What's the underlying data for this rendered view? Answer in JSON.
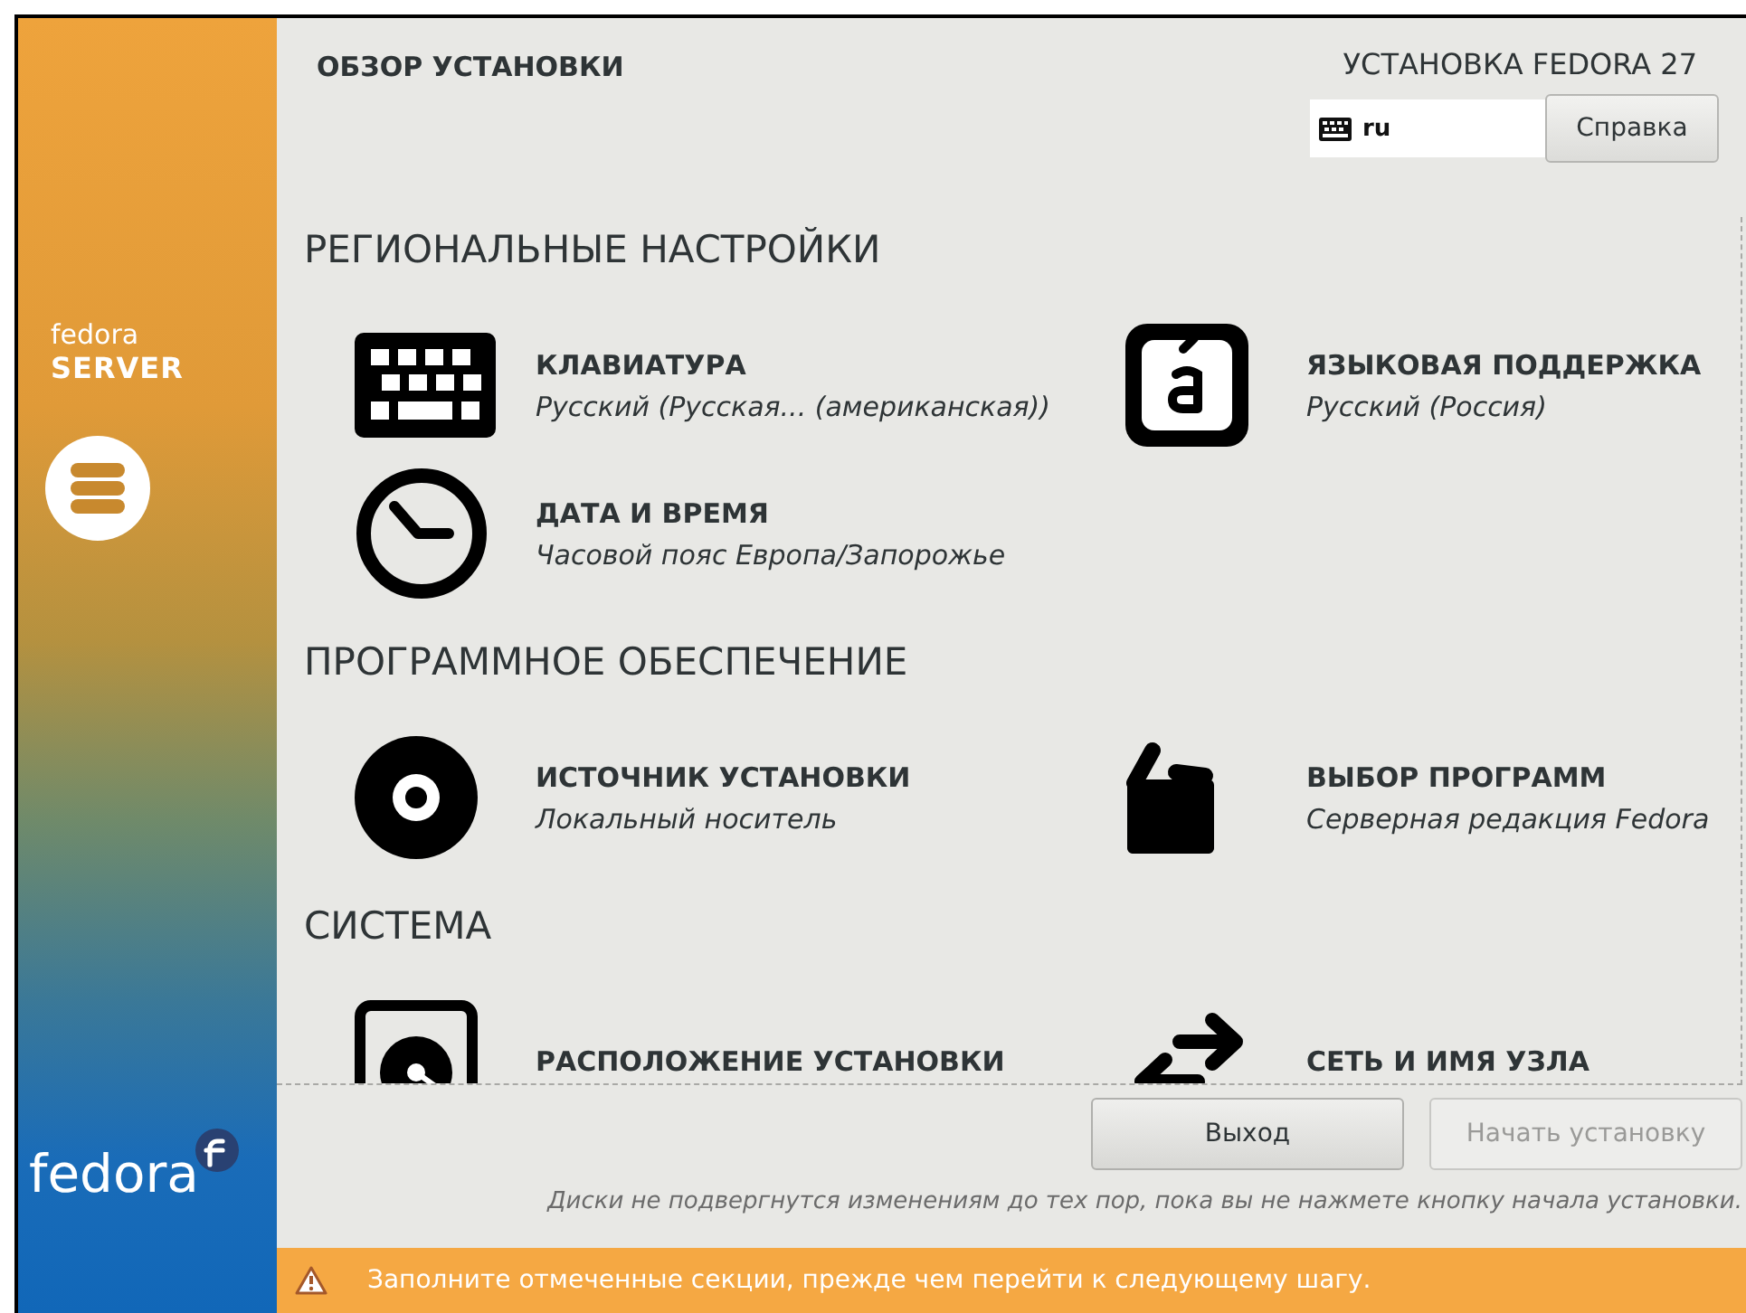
{
  "sidebar": {
    "brand_top": "fedora",
    "brand_edition": "SERVER",
    "brand_bottom": "fedora"
  },
  "header": {
    "title": "ОБЗОР УСТАНОВКИ",
    "product": "УСТАНОВКА FEDORA 27",
    "keyboard_layout": "ru",
    "help_button": "Справка"
  },
  "sections": [
    {
      "title": "РЕГИОНАЛЬНЫЕ НАСТРОЙКИ",
      "spokes": [
        {
          "kind": "keyboard",
          "title": "КЛАВИАТУРА",
          "status": "Русский (Русская... (американская))"
        },
        {
          "kind": "language",
          "title": "ЯЗЫКОВАЯ ПОДДЕРЖКА",
          "status": "Русский (Россия)"
        },
        {
          "kind": "time",
          "title": "ДАТА И ВРЕМЯ",
          "status": "Часовой пояс Европа/Запорожье"
        }
      ]
    },
    {
      "title": "ПРОГРАММНОЕ ОБЕСПЕЧЕНИЕ",
      "spokes": [
        {
          "kind": "source",
          "title": "ИСТОЧНИК УСТАНОВКИ",
          "status": "Локальный носитель"
        },
        {
          "kind": "software",
          "title": "ВЫБОР ПРОГРАММ",
          "status": "Серверная редакция Fedora"
        }
      ]
    },
    {
      "title": "СИСТЕМА",
      "spokes": [
        {
          "kind": "storage",
          "title": "РАСПОЛОЖЕНИЕ УСТАНОВКИ"
        },
        {
          "kind": "network",
          "title": "СЕТЬ И ИМЯ УЗЛА"
        }
      ]
    }
  ],
  "buttons": [
    {
      "label": "Выход",
      "disabled": false
    },
    {
      "label": "Начать установку",
      "disabled": true
    }
  ],
  "note": "Диски не подвергнутся изменениям до тех пор, пока вы не нажмете кнопку начала установки.",
  "warning": "Заполните отмеченные секции, прежде чем перейти к следующему шагу."
}
